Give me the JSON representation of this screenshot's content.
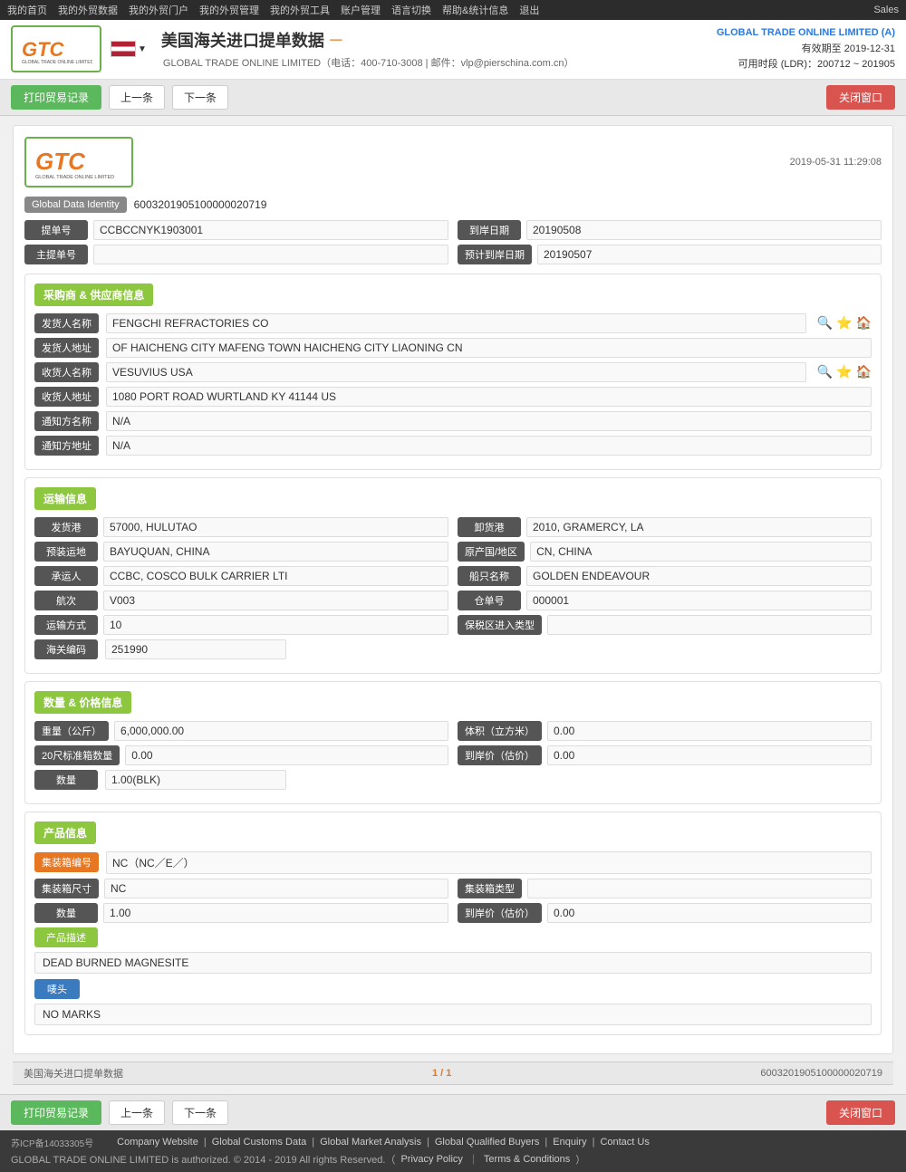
{
  "topnav": {
    "links": [
      "我的首页",
      "我的外贸数据",
      "我的外贸门户",
      "我的外贸管理",
      "我的外贸工具",
      "账户管理",
      "语言切换",
      "帮助&统计信息",
      "退出"
    ],
    "sales": "Sales"
  },
  "header": {
    "title": "美国海关进口提单数据",
    "dash": "－",
    "company_info": "GLOBAL TRADE ONLINE LIMITED（电话：400-710-3008 | 邮件：vlp@pierschina.com.cn）",
    "right_company": "GLOBAL TRADE ONLINE LIMITED (A)",
    "valid_until": "有效期至 2019-12-31",
    "ldr": "可用时段 (LDR)：200712 ~ 201905"
  },
  "toolbar": {
    "print_btn": "打印贸易记录",
    "prev_btn": "上一条",
    "next_btn": "下一条",
    "close_btn": "关闭窗口"
  },
  "record": {
    "datetime": "2019-05-31 11:29:08",
    "gdi_label": "Global Data Identity",
    "gdi_value": "6003201905100000020719",
    "fields": {
      "bill_no_label": "提单号",
      "bill_no_value": "CCBCCNYK1903001",
      "arrival_date_label": "到岸日期",
      "arrival_date_value": "20190508",
      "master_bill_label": "主提单号",
      "master_bill_value": "",
      "est_arrival_label": "预计到岸日期",
      "est_arrival_value": "20190507"
    }
  },
  "supplier_section": {
    "title": "采购商 & 供应商信息",
    "shipper_name_label": "发货人名称",
    "shipper_name_value": "FENGCHI REFRACTORIES CO",
    "shipper_addr_label": "发货人地址",
    "shipper_addr_value": "OF HAICHENG CITY MAFENG TOWN HAICHENG CITY LIAONING CN",
    "consignee_name_label": "收货人名称",
    "consignee_name_value": "VESUVIUS USA",
    "consignee_addr_label": "收货人地址",
    "consignee_addr_value": "1080 PORT ROAD WURTLAND KY 41144 US",
    "notify_name_label": "通知方名称",
    "notify_name_value": "N/A",
    "notify_addr_label": "通知方地址",
    "notify_addr_value": "N/A"
  },
  "transport_section": {
    "title": "运输信息",
    "origin_port_label": "发货港",
    "origin_port_value": "57000, HULUTAO",
    "dest_port_label": "卸货港",
    "dest_port_value": "2010, GRAMERCY, LA",
    "loading_place_label": "预装运地",
    "loading_place_value": "BAYUQUAN, CHINA",
    "origin_country_label": "原产国/地区",
    "origin_country_value": "CN, CHINA",
    "carrier_label": "承运人",
    "carrier_value": "CCBC, COSCO BULK CARRIER LTI",
    "vessel_name_label": "船只名称",
    "vessel_name_value": "GOLDEN ENDEAVOUR",
    "voyage_label": "航次",
    "voyage_value": "V003",
    "warehouse_no_label": "仓单号",
    "warehouse_no_value": "000001",
    "transport_mode_label": "运输方式",
    "transport_mode_value": "10",
    "bonded_type_label": "保税区进入类型",
    "bonded_type_value": "",
    "customs_code_label": "海关编码",
    "customs_code_value": "251990"
  },
  "quantity_section": {
    "title": "数量 & 价格信息",
    "weight_label": "重量（公斤）",
    "weight_value": "6,000,000.00",
    "volume_label": "体积（立方米）",
    "volume_value": "0.00",
    "teu20_label": "20尺标准箱数量",
    "teu20_value": "0.00",
    "arrival_price_label": "到岸价（估价）",
    "arrival_price_value": "0.00",
    "quantity_label": "数量",
    "quantity_value": "1.00(BLK)"
  },
  "product_section": {
    "title": "产品信息",
    "container_no_label": "集装箱编号",
    "container_no_value": "NC（NC／E／）",
    "container_size_label": "集装箱尺寸",
    "container_size_value": "NC",
    "container_type_label": "集装箱类型",
    "container_type_value": "",
    "quantity_label": "数量",
    "quantity_value": "1.00",
    "unit_price_label": "到岸价（估价）",
    "unit_price_value": "0.00",
    "desc_label": "产品描述",
    "desc_value": "DEAD BURNED MAGNESITE",
    "marks_label": "唛头",
    "marks_value": "NO MARKS"
  },
  "bottom_bar": {
    "left": "美国海关进口提单数据",
    "center": "1 / 1",
    "right": "6003201905100000020719"
  },
  "footer_toolbar": {
    "print_btn": "打印贸易记录",
    "prev_btn": "上一条",
    "next_btn": "下一条",
    "close_btn": "关闭窗口"
  },
  "footer": {
    "icp": "苏ICP备14033305号",
    "links": [
      "Company Website",
      "Global Customs Data",
      "Global Market Analysis",
      "Global Qualified Buyers",
      "Enquiry",
      "Contact Us"
    ],
    "copyright": "GLOBAL TRADE ONLINE LIMITED is authorized. © 2014 - 2019 All rights Reserved.（",
    "privacy": "Privacy Policy",
    "separator1": "｜",
    "terms": "Terms & Conditions",
    "close_paren": "）"
  }
}
